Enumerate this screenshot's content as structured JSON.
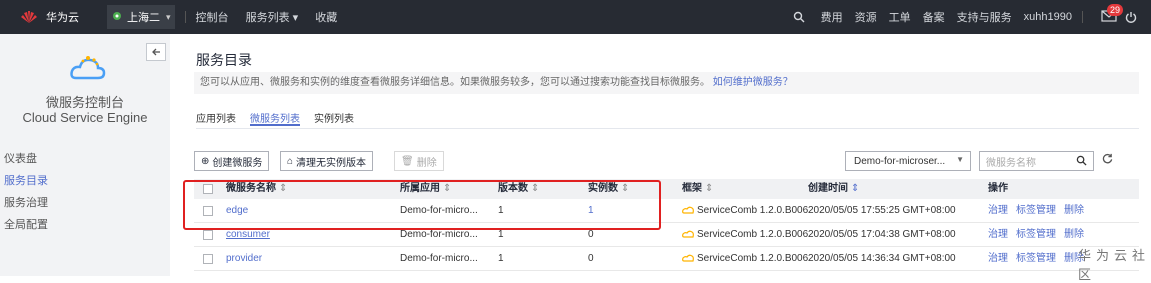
{
  "topbar": {
    "brand": "华为云",
    "region": "上海二",
    "nav": [
      "控制台",
      "服务列表 ▾",
      "收藏"
    ],
    "right_items": [
      "费用",
      "资源",
      "工单",
      "备案",
      "支持与服务"
    ],
    "username": "xuhh1990",
    "mail_badge": "29"
  },
  "sidebar": {
    "title_cn": "微服务控制台",
    "title_en": "Cloud Service Engine",
    "items": [
      {
        "label": "仪表盘",
        "active": false
      },
      {
        "label": "服务目录",
        "active": true
      },
      {
        "label": "服务治理",
        "active": false
      },
      {
        "label": "全局配置",
        "active": false
      }
    ]
  },
  "page": {
    "title": "服务目录",
    "info_text": "您可以从应用、微服务和实例的维度查看微服务详细信息。如果微服务较多，您可以通过搜索功能查找目标微服务。",
    "info_link": "如何维护微服务？",
    "tabs": [
      {
        "label": "应用列表",
        "active": false
      },
      {
        "label": "微服务列表",
        "active": true
      },
      {
        "label": "实例列表",
        "active": false
      }
    ]
  },
  "toolbar": {
    "create_label": "创建微服务",
    "clean_label": "清理无实例版本",
    "delete_label": "删除",
    "app_select": "Demo-for-microser...",
    "search_placeholder": "微服务名称"
  },
  "table": {
    "headers": {
      "name": "微服务名称",
      "app": "所属应用",
      "versions": "版本数",
      "instances": "实例数",
      "framework": "框架",
      "created": "创建时间",
      "ops": "操作"
    },
    "rows": [
      {
        "name": "edge",
        "app": "Demo-for-micro...",
        "versions": "1",
        "instances": "1",
        "framework": "ServiceComb 1.2.0.B006",
        "created": "2020/05/05 17:55:25 GMT+08:00",
        "ops": [
          "治理",
          "标签管理",
          "删除"
        ]
      },
      {
        "name": "consumer",
        "app": "Demo-for-micro...",
        "versions": "1",
        "instances": "0",
        "framework": "ServiceComb 1.2.0.B006",
        "created": "2020/05/05 17:04:38 GMT+08:00",
        "ops": [
          "治理",
          "标签管理",
          "删除"
        ]
      },
      {
        "name": "provider",
        "app": "Demo-for-micro...",
        "versions": "1",
        "instances": "0",
        "framework": "ServiceComb 1.2.0.B006",
        "created": "2020/05/05 14:36:34 GMT+08:00",
        "ops": [
          "治理",
          "标签管理",
          "删除"
        ]
      }
    ]
  },
  "watermark": "华为云社区",
  "colors": {
    "accent": "#526ecc",
    "topbar": "#272b33",
    "highlight": "#e02020"
  }
}
